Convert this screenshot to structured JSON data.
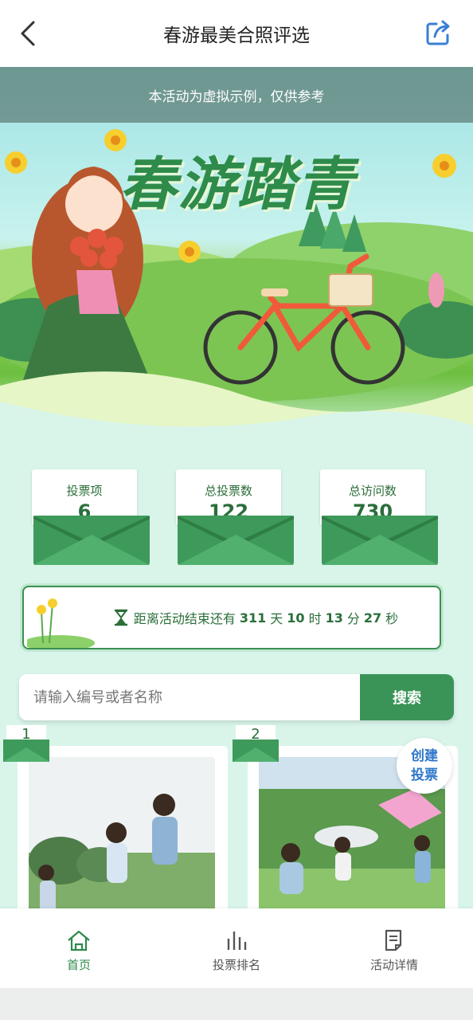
{
  "header": {
    "title": "春游最美合照评选",
    "back_icon": "back-arrow-icon",
    "share_icon": "share-icon"
  },
  "banner": {
    "notice": "本活动为虚拟示例，仅供参考",
    "title": "春游踏青"
  },
  "stats": [
    {
      "label": "投票项",
      "value": "6"
    },
    {
      "label": "总投票数",
      "value": "122"
    },
    {
      "label": "总访问数",
      "value": "730"
    }
  ],
  "countdown": {
    "prefix": "距离活动结束还有",
    "days": "311",
    "days_unit": "天",
    "hours": "10",
    "hours_unit": "时",
    "minutes": "13",
    "minutes_unit": "分",
    "seconds": "27",
    "seconds_unit": "秒"
  },
  "search": {
    "placeholder": "请输入编号或者名称",
    "button_label": "搜索"
  },
  "entries": [
    {
      "number": "1"
    },
    {
      "number": "2"
    }
  ],
  "create_vote": {
    "line1": "创建",
    "line2": "投票"
  },
  "bottom_nav": [
    {
      "label": "首页",
      "icon": "home-icon",
      "active": true
    },
    {
      "label": "投票排名",
      "icon": "bar-chart-icon",
      "active": false
    },
    {
      "label": "活动详情",
      "icon": "document-icon",
      "active": false
    }
  ],
  "colors": {
    "primary_green": "#3a9457",
    "dark_green": "#2a6e3a",
    "background": "#d9f5ea",
    "create_vote_blue": "#2f77c9"
  }
}
